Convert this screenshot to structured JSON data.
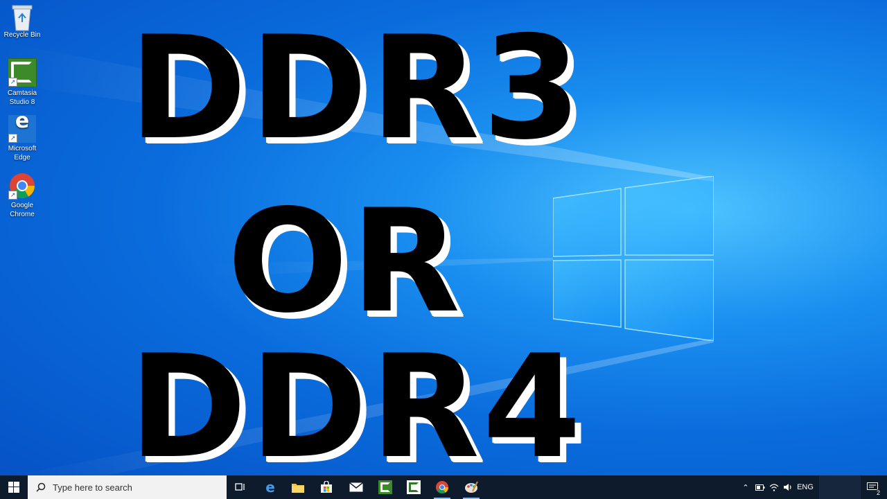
{
  "desktop": {
    "icons": [
      {
        "label": "Recycle Bin"
      },
      {
        "label": "Camtasia Studio 8"
      },
      {
        "label": "Microsoft Edge"
      },
      {
        "label": "Google Chrome"
      }
    ]
  },
  "overlay": {
    "line1": "DDR3",
    "line2": "OR",
    "line3": "DDR4"
  },
  "taskbar": {
    "search_placeholder": "Type here to search",
    "apps": [
      "task-view",
      "edge",
      "file-explorer",
      "store",
      "mail",
      "camtasia-recorder",
      "camtasia-studio",
      "chrome",
      "paint"
    ],
    "tray": {
      "language": "ENG",
      "notification_count": "2"
    }
  },
  "colors": {
    "accent": "#0a6cdc",
    "taskbar": "#0e1b2d"
  }
}
